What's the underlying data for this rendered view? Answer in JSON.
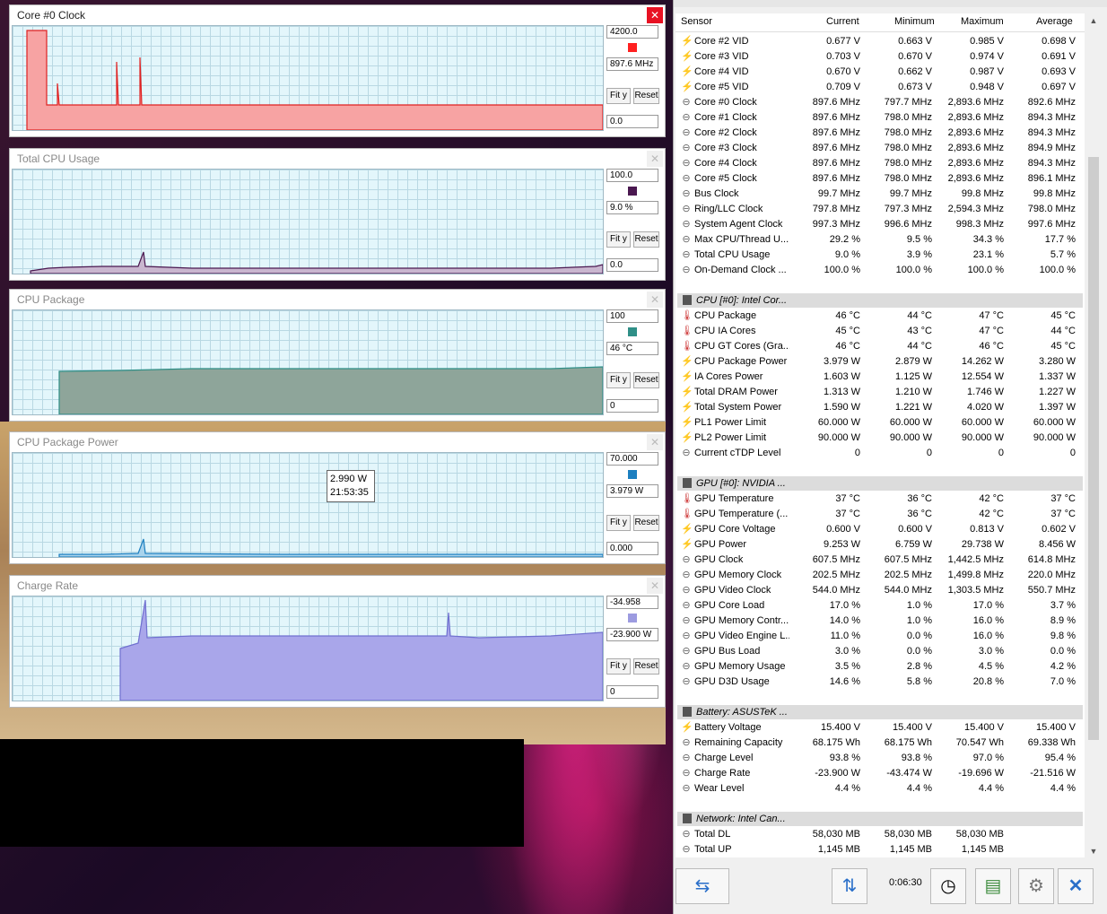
{
  "graphs": [
    {
      "title": "Core #0 Clock",
      "max": "4200.0",
      "current": "897.6 MHz",
      "min": "0.0",
      "color": "#ff2020",
      "fill": "#f7a3a3",
      "line": "#e02020",
      "fit": "Fit y",
      "reset": "Reset",
      "active": true
    },
    {
      "title": "Total CPU Usage",
      "max": "100.0",
      "current": "9.0 %",
      "min": "0.0",
      "color": "#4a1850",
      "fill": "#c9b6cf",
      "line": "#4a1850",
      "fit": "Fit y",
      "reset": "Reset",
      "active": false
    },
    {
      "title": "CPU Package",
      "max": "100",
      "current": "46 °C",
      "min": "0",
      "color": "#2f8f87",
      "fill": "#8ea59a",
      "line": "#2f8f87",
      "fit": "Fit y",
      "reset": "Reset",
      "active": false
    },
    {
      "title": "CPU Package Power",
      "max": "70.000",
      "current": "3.979 W",
      "min": "0.000",
      "color": "#1c7fc0",
      "fill": "#a9d3ec",
      "line": "#1c7fc0",
      "fit": "Fit y",
      "reset": "Reset",
      "active": false
    },
    {
      "title": "Charge Rate",
      "max": "-34.958",
      "current": "-23.900 W",
      "min": "0",
      "color": "#9c9be0",
      "fill": "#a9a6ea",
      "line": "#7070d0",
      "fit": "Fit y",
      "reset": "Reset",
      "active": false
    }
  ],
  "tooltip": {
    "value": "2.990 W",
    "time": "21:53:35"
  },
  "sensor_header": {
    "sensor": "Sensor",
    "current": "Current",
    "minimum": "Minimum",
    "maximum": "Maximum",
    "average": "Average"
  },
  "sensor_rows": [
    {
      "type": "row",
      "icon": "volt",
      "name": "Core #2 VID",
      "cur": "0.677 V",
      "min": "0.663 V",
      "max": "0.985 V",
      "avg": "0.698 V"
    },
    {
      "type": "row",
      "icon": "volt",
      "name": "Core #3 VID",
      "cur": "0.703 V",
      "min": "0.670 V",
      "max": "0.974 V",
      "avg": "0.691 V"
    },
    {
      "type": "row",
      "icon": "volt",
      "name": "Core #4 VID",
      "cur": "0.670 V",
      "min": "0.662 V",
      "max": "0.987 V",
      "avg": "0.693 V"
    },
    {
      "type": "row",
      "icon": "volt",
      "name": "Core #5 VID",
      "cur": "0.709 V",
      "min": "0.673 V",
      "max": "0.948 V",
      "avg": "0.697 V"
    },
    {
      "type": "row",
      "icon": "clock",
      "name": "Core #0 Clock",
      "cur": "897.6 MHz",
      "min": "797.7 MHz",
      "max": "2,893.6 MHz",
      "avg": "892.6 MHz"
    },
    {
      "type": "row",
      "icon": "clock",
      "name": "Core #1 Clock",
      "cur": "897.6 MHz",
      "min": "798.0 MHz",
      "max": "2,893.6 MHz",
      "avg": "894.3 MHz"
    },
    {
      "type": "row",
      "icon": "clock",
      "name": "Core #2 Clock",
      "cur": "897.6 MHz",
      "min": "798.0 MHz",
      "max": "2,893.6 MHz",
      "avg": "894.3 MHz"
    },
    {
      "type": "row",
      "icon": "clock",
      "name": "Core #3 Clock",
      "cur": "897.6 MHz",
      "min": "798.0 MHz",
      "max": "2,893.6 MHz",
      "avg": "894.9 MHz"
    },
    {
      "type": "row",
      "icon": "clock",
      "name": "Core #4 Clock",
      "cur": "897.6 MHz",
      "min": "798.0 MHz",
      "max": "2,893.6 MHz",
      "avg": "894.3 MHz"
    },
    {
      "type": "row",
      "icon": "clock",
      "name": "Core #5 Clock",
      "cur": "897.6 MHz",
      "min": "798.0 MHz",
      "max": "2,893.6 MHz",
      "avg": "896.1 MHz"
    },
    {
      "type": "row",
      "icon": "clock",
      "name": "Bus Clock",
      "cur": "99.7 MHz",
      "min": "99.7 MHz",
      "max": "99.8 MHz",
      "avg": "99.8 MHz"
    },
    {
      "type": "row",
      "icon": "clock",
      "name": "Ring/LLC Clock",
      "cur": "797.8 MHz",
      "min": "797.3 MHz",
      "max": "2,594.3 MHz",
      "avg": "798.0 MHz"
    },
    {
      "type": "row",
      "icon": "clock",
      "name": "System Agent Clock",
      "cur": "997.3 MHz",
      "min": "996.6 MHz",
      "max": "998.3 MHz",
      "avg": "997.6 MHz"
    },
    {
      "type": "row",
      "icon": "clock",
      "name": "Max CPU/Thread U...",
      "cur": "29.2 %",
      "min": "9.5 %",
      "max": "34.3 %",
      "avg": "17.7 %"
    },
    {
      "type": "row",
      "icon": "clock",
      "name": "Total CPU Usage",
      "cur": "9.0 %",
      "min": "3.9 %",
      "max": "23.1 %",
      "avg": "5.7 %"
    },
    {
      "type": "row",
      "icon": "clock",
      "name": "On-Demand Clock ...",
      "cur": "100.0 %",
      "min": "100.0 %",
      "max": "100.0 %",
      "avg": "100.0 %"
    },
    {
      "type": "blank"
    },
    {
      "type": "group",
      "name": "CPU [#0]: Intel Cor..."
    },
    {
      "type": "row",
      "icon": "temp",
      "name": "CPU Package",
      "cur": "46 °C",
      "min": "44 °C",
      "max": "47 °C",
      "avg": "45 °C"
    },
    {
      "type": "row",
      "icon": "temp",
      "name": "CPU IA Cores",
      "cur": "45 °C",
      "min": "43 °C",
      "max": "47 °C",
      "avg": "44 °C"
    },
    {
      "type": "row",
      "icon": "temp",
      "name": "CPU GT Cores (Gra...",
      "cur": "46 °C",
      "min": "44 °C",
      "max": "46 °C",
      "avg": "45 °C"
    },
    {
      "type": "row",
      "icon": "pow",
      "name": "CPU Package Power",
      "cur": "3.979 W",
      "min": "2.879 W",
      "max": "14.262 W",
      "avg": "3.280 W"
    },
    {
      "type": "row",
      "icon": "pow",
      "name": "IA Cores Power",
      "cur": "1.603 W",
      "min": "1.125 W",
      "max": "12.554 W",
      "avg": "1.337 W"
    },
    {
      "type": "row",
      "icon": "pow",
      "name": "Total DRAM Power",
      "cur": "1.313 W",
      "min": "1.210 W",
      "max": "1.746 W",
      "avg": "1.227 W"
    },
    {
      "type": "row",
      "icon": "pow",
      "name": "Total System Power",
      "cur": "1.590 W",
      "min": "1.221 W",
      "max": "4.020 W",
      "avg": "1.397 W"
    },
    {
      "type": "row",
      "icon": "pow",
      "name": "PL1 Power Limit",
      "cur": "60.000 W",
      "min": "60.000 W",
      "max": "60.000 W",
      "avg": "60.000 W"
    },
    {
      "type": "row",
      "icon": "pow",
      "name": "PL2 Power Limit",
      "cur": "90.000 W",
      "min": "90.000 W",
      "max": "90.000 W",
      "avg": "90.000 W"
    },
    {
      "type": "row",
      "icon": "clock",
      "name": "Current cTDP Level",
      "cur": "0",
      "min": "0",
      "max": "0",
      "avg": "0"
    },
    {
      "type": "blank"
    },
    {
      "type": "group",
      "name": "GPU [#0]: NVIDIA ..."
    },
    {
      "type": "row",
      "icon": "temp",
      "name": "GPU Temperature",
      "cur": "37 °C",
      "min": "36 °C",
      "max": "42 °C",
      "avg": "37 °C"
    },
    {
      "type": "row",
      "icon": "temp",
      "name": "GPU Temperature (...",
      "cur": "37 °C",
      "min": "36 °C",
      "max": "42 °C",
      "avg": "37 °C"
    },
    {
      "type": "row",
      "icon": "volt",
      "name": "GPU Core Voltage",
      "cur": "0.600 V",
      "min": "0.600 V",
      "max": "0.813 V",
      "avg": "0.602 V"
    },
    {
      "type": "row",
      "icon": "pow",
      "name": "GPU Power",
      "cur": "9.253 W",
      "min": "6.759 W",
      "max": "29.738 W",
      "avg": "8.456 W"
    },
    {
      "type": "row",
      "icon": "clock",
      "name": "GPU Clock",
      "cur": "607.5 MHz",
      "min": "607.5 MHz",
      "max": "1,442.5 MHz",
      "avg": "614.8 MHz"
    },
    {
      "type": "row",
      "icon": "clock",
      "name": "GPU Memory Clock",
      "cur": "202.5 MHz",
      "min": "202.5 MHz",
      "max": "1,499.8 MHz",
      "avg": "220.0 MHz"
    },
    {
      "type": "row",
      "icon": "clock",
      "name": "GPU Video Clock",
      "cur": "544.0 MHz",
      "min": "544.0 MHz",
      "max": "1,303.5 MHz",
      "avg": "550.7 MHz"
    },
    {
      "type": "row",
      "icon": "clock",
      "name": "GPU Core Load",
      "cur": "17.0 %",
      "min": "1.0 %",
      "max": "17.0 %",
      "avg": "3.7 %"
    },
    {
      "type": "row",
      "icon": "clock",
      "name": "GPU Memory Contr...",
      "cur": "14.0 %",
      "min": "1.0 %",
      "max": "16.0 %",
      "avg": "8.9 %"
    },
    {
      "type": "row",
      "icon": "clock",
      "name": "GPU Video Engine L...",
      "cur": "11.0 %",
      "min": "0.0 %",
      "max": "16.0 %",
      "avg": "9.8 %"
    },
    {
      "type": "row",
      "icon": "clock",
      "name": "GPU Bus Load",
      "cur": "3.0 %",
      "min": "0.0 %",
      "max": "3.0 %",
      "avg": "0.0 %"
    },
    {
      "type": "row",
      "icon": "clock",
      "name": "GPU Memory Usage",
      "cur": "3.5 %",
      "min": "2.8 %",
      "max": "4.5 %",
      "avg": "4.2 %"
    },
    {
      "type": "row",
      "icon": "clock",
      "name": "GPU D3D Usage",
      "cur": "14.6 %",
      "min": "5.8 %",
      "max": "20.8 %",
      "avg": "7.0 %"
    },
    {
      "type": "blank"
    },
    {
      "type": "group",
      "name": "Battery: ASUSTeK ..."
    },
    {
      "type": "row",
      "icon": "volt",
      "name": "Battery Voltage",
      "cur": "15.400 V",
      "min": "15.400 V",
      "max": "15.400 V",
      "avg": "15.400 V"
    },
    {
      "type": "row",
      "icon": "clock",
      "name": "Remaining Capacity",
      "cur": "68.175 Wh",
      "min": "68.175 Wh",
      "max": "70.547 Wh",
      "avg": "69.338 Wh"
    },
    {
      "type": "row",
      "icon": "clock",
      "name": "Charge Level",
      "cur": "93.8 %",
      "min": "93.8 %",
      "max": "97.0 %",
      "avg": "95.4 %"
    },
    {
      "type": "row",
      "icon": "clock",
      "name": "Charge Rate",
      "cur": "-23.900 W",
      "min": "-43.474 W",
      "max": "-19.696 W",
      "avg": "-21.516 W"
    },
    {
      "type": "row",
      "icon": "clock",
      "name": "Wear Level",
      "cur": "4.4 %",
      "min": "4.4 %",
      "max": "4.4 %",
      "avg": "4.4 %"
    },
    {
      "type": "blank"
    },
    {
      "type": "group",
      "name": "Network: Intel Can..."
    },
    {
      "type": "row",
      "icon": "clock",
      "name": "Total DL",
      "cur": "58,030 MB",
      "min": "58,030 MB",
      "max": "58,030 MB",
      "avg": ""
    },
    {
      "type": "row",
      "icon": "clock",
      "name": "Total UP",
      "cur": "1,145 MB",
      "min": "1,145 MB",
      "max": "1,145 MB",
      "avg": ""
    }
  ],
  "toolbar": {
    "timer": "0:06:30"
  }
}
